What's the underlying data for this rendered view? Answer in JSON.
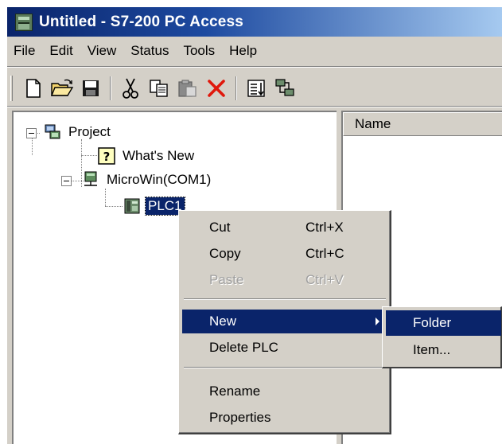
{
  "window": {
    "title": "Untitled - S7-200 PC Access"
  },
  "menubar": [
    "File",
    "Edit",
    "View",
    "Status",
    "Tools",
    "Help"
  ],
  "toolbar": {
    "icons": [
      "new-file-icon",
      "open-folder-icon",
      "save-icon",
      "cut-icon",
      "copy-icon",
      "paste-icon",
      "delete-icon",
      "sort-list-icon",
      "network-icon"
    ]
  },
  "tree": {
    "project": "Project",
    "whats_new": "What's New",
    "microwin": "MicroWin(COM1)",
    "plc": "PLC1"
  },
  "list": {
    "column_name": "Name"
  },
  "context_menu": {
    "cut": {
      "label": "Cut",
      "accel": "Ctrl+X"
    },
    "copy": {
      "label": "Copy",
      "accel": "Ctrl+C"
    },
    "paste": {
      "label": "Paste",
      "accel": "Ctrl+V",
      "disabled": true
    },
    "new": {
      "label": "New"
    },
    "delete_plc": {
      "label": "Delete PLC"
    },
    "rename": {
      "label": "Rename"
    },
    "properties": {
      "label": "Properties"
    }
  },
  "submenu": {
    "folder": "Folder",
    "item": "Item..."
  },
  "colors": {
    "selection": "#0a246a",
    "face": "#d4d0c8",
    "title_start": "#0a246a",
    "title_end": "#a6caf0"
  }
}
